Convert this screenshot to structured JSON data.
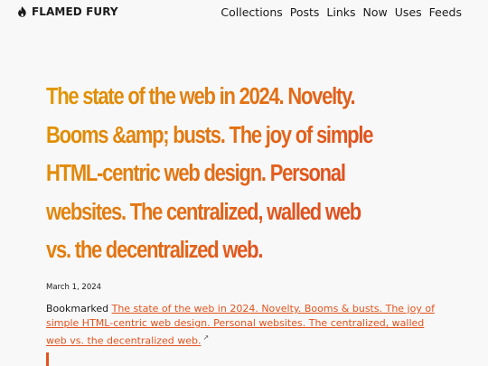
{
  "brand": {
    "name": "FLAMED FURY"
  },
  "nav": {
    "items": [
      "Collections",
      "Posts",
      "Links",
      "Now",
      "Uses",
      "Feeds"
    ]
  },
  "post": {
    "title": "The state of the web in 2024. Novelty. Booms &amp; busts. The joy of simple HTML-centric web design. Personal websites. The centralized, walled web vs. the decentralized web.",
    "date": "March 1, 2024",
    "bookmark_prefix": "Bookmarked",
    "bookmark_link": "The state of the web in 2024. Novelty. Booms & busts. The joy of simple HTML-centric web design. Personal websites. The centralized, walled web vs. the decentralized web.",
    "external_icon": "↗"
  },
  "colors": {
    "accent": "#e2541e",
    "gradient_start": "#e09a00"
  }
}
